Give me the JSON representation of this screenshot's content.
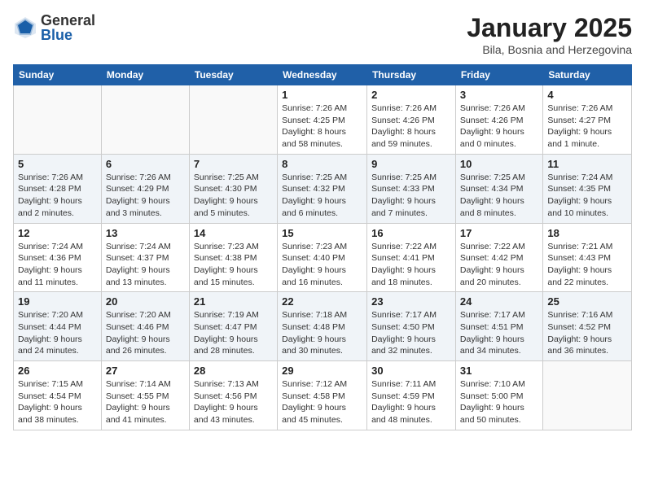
{
  "header": {
    "logo_general": "General",
    "logo_blue": "Blue",
    "month_title": "January 2025",
    "location": "Bila, Bosnia and Herzegovina"
  },
  "weekdays": [
    "Sunday",
    "Monday",
    "Tuesday",
    "Wednesday",
    "Thursday",
    "Friday",
    "Saturday"
  ],
  "weeks": [
    [
      {
        "day": "",
        "info": ""
      },
      {
        "day": "",
        "info": ""
      },
      {
        "day": "",
        "info": ""
      },
      {
        "day": "1",
        "info": "Sunrise: 7:26 AM\nSunset: 4:25 PM\nDaylight: 8 hours and 58 minutes."
      },
      {
        "day": "2",
        "info": "Sunrise: 7:26 AM\nSunset: 4:26 PM\nDaylight: 8 hours and 59 minutes."
      },
      {
        "day": "3",
        "info": "Sunrise: 7:26 AM\nSunset: 4:26 PM\nDaylight: 9 hours and 0 minutes."
      },
      {
        "day": "4",
        "info": "Sunrise: 7:26 AM\nSunset: 4:27 PM\nDaylight: 9 hours and 1 minute."
      }
    ],
    [
      {
        "day": "5",
        "info": "Sunrise: 7:26 AM\nSunset: 4:28 PM\nDaylight: 9 hours and 2 minutes."
      },
      {
        "day": "6",
        "info": "Sunrise: 7:26 AM\nSunset: 4:29 PM\nDaylight: 9 hours and 3 minutes."
      },
      {
        "day": "7",
        "info": "Sunrise: 7:25 AM\nSunset: 4:30 PM\nDaylight: 9 hours and 5 minutes."
      },
      {
        "day": "8",
        "info": "Sunrise: 7:25 AM\nSunset: 4:32 PM\nDaylight: 9 hours and 6 minutes."
      },
      {
        "day": "9",
        "info": "Sunrise: 7:25 AM\nSunset: 4:33 PM\nDaylight: 9 hours and 7 minutes."
      },
      {
        "day": "10",
        "info": "Sunrise: 7:25 AM\nSunset: 4:34 PM\nDaylight: 9 hours and 8 minutes."
      },
      {
        "day": "11",
        "info": "Sunrise: 7:24 AM\nSunset: 4:35 PM\nDaylight: 9 hours and 10 minutes."
      }
    ],
    [
      {
        "day": "12",
        "info": "Sunrise: 7:24 AM\nSunset: 4:36 PM\nDaylight: 9 hours and 11 minutes."
      },
      {
        "day": "13",
        "info": "Sunrise: 7:24 AM\nSunset: 4:37 PM\nDaylight: 9 hours and 13 minutes."
      },
      {
        "day": "14",
        "info": "Sunrise: 7:23 AM\nSunset: 4:38 PM\nDaylight: 9 hours and 15 minutes."
      },
      {
        "day": "15",
        "info": "Sunrise: 7:23 AM\nSunset: 4:40 PM\nDaylight: 9 hours and 16 minutes."
      },
      {
        "day": "16",
        "info": "Sunrise: 7:22 AM\nSunset: 4:41 PM\nDaylight: 9 hours and 18 minutes."
      },
      {
        "day": "17",
        "info": "Sunrise: 7:22 AM\nSunset: 4:42 PM\nDaylight: 9 hours and 20 minutes."
      },
      {
        "day": "18",
        "info": "Sunrise: 7:21 AM\nSunset: 4:43 PM\nDaylight: 9 hours and 22 minutes."
      }
    ],
    [
      {
        "day": "19",
        "info": "Sunrise: 7:20 AM\nSunset: 4:44 PM\nDaylight: 9 hours and 24 minutes."
      },
      {
        "day": "20",
        "info": "Sunrise: 7:20 AM\nSunset: 4:46 PM\nDaylight: 9 hours and 26 minutes."
      },
      {
        "day": "21",
        "info": "Sunrise: 7:19 AM\nSunset: 4:47 PM\nDaylight: 9 hours and 28 minutes."
      },
      {
        "day": "22",
        "info": "Sunrise: 7:18 AM\nSunset: 4:48 PM\nDaylight: 9 hours and 30 minutes."
      },
      {
        "day": "23",
        "info": "Sunrise: 7:17 AM\nSunset: 4:50 PM\nDaylight: 9 hours and 32 minutes."
      },
      {
        "day": "24",
        "info": "Sunrise: 7:17 AM\nSunset: 4:51 PM\nDaylight: 9 hours and 34 minutes."
      },
      {
        "day": "25",
        "info": "Sunrise: 7:16 AM\nSunset: 4:52 PM\nDaylight: 9 hours and 36 minutes."
      }
    ],
    [
      {
        "day": "26",
        "info": "Sunrise: 7:15 AM\nSunset: 4:54 PM\nDaylight: 9 hours and 38 minutes."
      },
      {
        "day": "27",
        "info": "Sunrise: 7:14 AM\nSunset: 4:55 PM\nDaylight: 9 hours and 41 minutes."
      },
      {
        "day": "28",
        "info": "Sunrise: 7:13 AM\nSunset: 4:56 PM\nDaylight: 9 hours and 43 minutes."
      },
      {
        "day": "29",
        "info": "Sunrise: 7:12 AM\nSunset: 4:58 PM\nDaylight: 9 hours and 45 minutes."
      },
      {
        "day": "30",
        "info": "Sunrise: 7:11 AM\nSunset: 4:59 PM\nDaylight: 9 hours and 48 minutes."
      },
      {
        "day": "31",
        "info": "Sunrise: 7:10 AM\nSunset: 5:00 PM\nDaylight: 9 hours and 50 minutes."
      },
      {
        "day": "",
        "info": ""
      }
    ]
  ]
}
